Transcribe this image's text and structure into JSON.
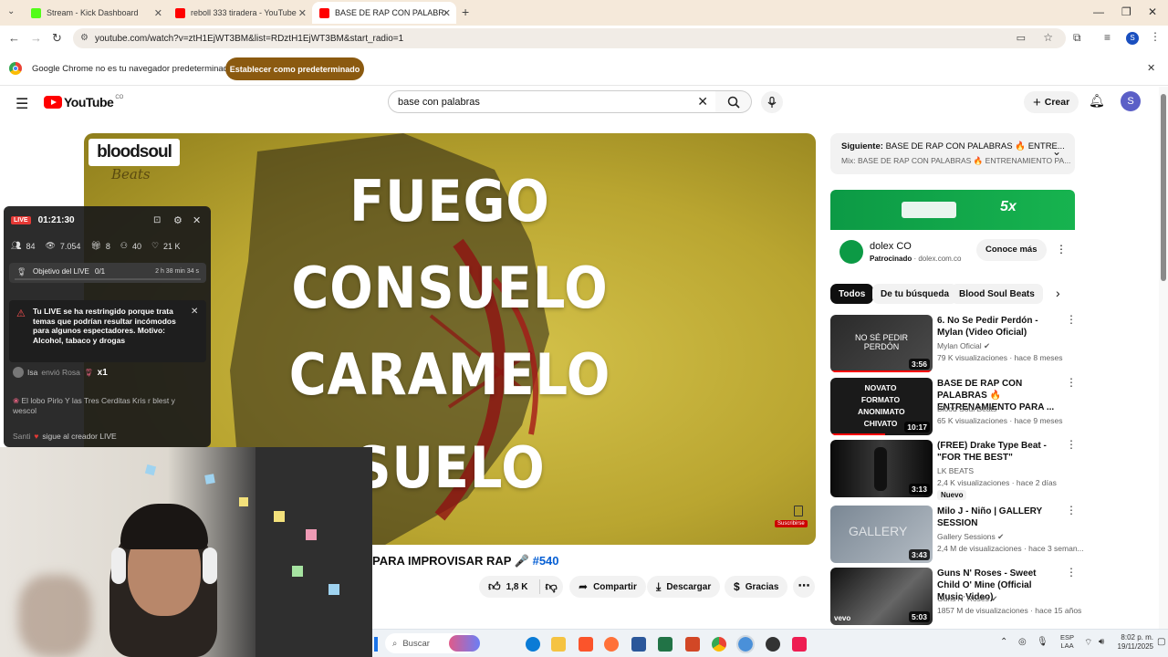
{
  "tabs": [
    {
      "title": "Stream - Kick Dashboard",
      "icon": "kick-icon",
      "color": "#53fc18"
    },
    {
      "title": "reboll 333 tiradera - YouTube",
      "icon": "youtube-icon",
      "color": "#ff0000"
    },
    {
      "title": "BASE DE RAP CON PALABRAS 🔥",
      "icon": "youtube-icon",
      "color": "#ff0000"
    }
  ],
  "address": {
    "url": "youtube.com/watch?v=ztH1EjWT3BM&list=RDztH1EjWT3BM&start_radio=1"
  },
  "infobar": {
    "message": "Google Chrome no es tu navegador predeterminado",
    "button": "Establecer como predeterminado"
  },
  "yt": {
    "logo": "YouTube",
    "region": "CO",
    "search_value": "base con palabras",
    "create_label": "Crear",
    "avatar_letter": "S"
  },
  "video": {
    "watermark": "bloodsoul",
    "watermark_sub": "Beats",
    "words": [
      "FUEGO",
      "CONSUELO",
      "CARAMELO",
      "SUELO"
    ],
    "subscribe_label": "Suscribirse",
    "title_visible": "PARA IMPROVISAR RAP 🎤",
    "hashtag": "#540"
  },
  "actions": {
    "likes": "1,8 K",
    "share": "Compartir",
    "download": "Descargar",
    "thanks": "Gracias"
  },
  "kick": {
    "live_badge": "LIVE",
    "timer": "01:21:30",
    "stats": {
      "followers": "84",
      "views": "7.054",
      "gifts": "8",
      "subs": "40",
      "likes": "21 K"
    },
    "goal_label": "Objetivo del LIVE",
    "goal_value": "0/1",
    "goal_time": "2 h 38 min 34 s",
    "warning": "Tu LIVE se ha restringido porque trata temas que podrían resultar incómodos para algunos espectadores. Motivo: Alcohol, tabaco y drogas",
    "gift_user": "Isa",
    "gift_text": "envió Rosa",
    "gift_count": "x1",
    "chat_text": "El lobo Pirlo Y las Tres Cerditas Kris r blest y wescol",
    "follow_user": "Santi",
    "follow_text": "sigue al creador LIVE"
  },
  "next": {
    "label": "Siguiente:",
    "title": "BASE DE RAP CON PALABRAS 🔥 ENTRE...",
    "mix": "Mix: BASE DE RAP CON PALABRAS 🔥 ENTRENAMIENTO PA..."
  },
  "ad": {
    "brand": "dolex CO",
    "sponsored": "Patrocinado",
    "domain": "dolex.com.co",
    "cta": "Conoce más",
    "banner_text": "5x"
  },
  "chips": [
    "Todos",
    "De tu búsqueda",
    "Blood Soul Beats"
  ],
  "recs": [
    {
      "title": "6. No Se Pedir Perdón - Mylan (Video Oficial)",
      "channel": "Mylan Oficial",
      "verified": true,
      "meta": "79 K visualizaciones · hace 8 meses",
      "duration": "3:56",
      "thumb_text": "NO SÉ PEDIR PERDÓN",
      "new": false
    },
    {
      "title": "BASE DE RAP CON PALABRAS 🔥 ENTRENAMIENTO PARA ...",
      "channel": "Blood Soul Beats",
      "verified": false,
      "meta": "65 K visualizaciones · hace 9 meses",
      "duration": "10:17",
      "thumb_text": "NOVATO FORMATO ANONIMATO CHIVATO",
      "new": false
    },
    {
      "title": "(FREE) Drake Type Beat - \"FOR THE BEST\"",
      "channel": "LK BEATS",
      "verified": false,
      "meta": "2,4 K visualizaciones · hace 2 días",
      "duration": "3:13",
      "thumb_text": "",
      "new": true,
      "new_label": "Nuevo"
    },
    {
      "title": "Milo J - Niño | GALLERY SESSION",
      "channel": "Gallery Sessions",
      "verified": true,
      "meta": "2,4 M de visualizaciones · hace 3 seman...",
      "duration": "3:43",
      "thumb_text": "GALLERY",
      "new": false
    },
    {
      "title": "Guns N' Roses - Sweet Child O' Mine (Official Music Video)",
      "channel": "Guns N' Roses",
      "verified": true,
      "meta": "1857 M de visualizaciones · hace 15 años",
      "duration": "5:03",
      "thumb_text": "vevo",
      "new": false
    }
  ],
  "taskbar": {
    "search": "Buscar",
    "lang": "ESP",
    "lang2": "LAA",
    "time": "8:02 p. m.",
    "date": "19/11/2025"
  }
}
